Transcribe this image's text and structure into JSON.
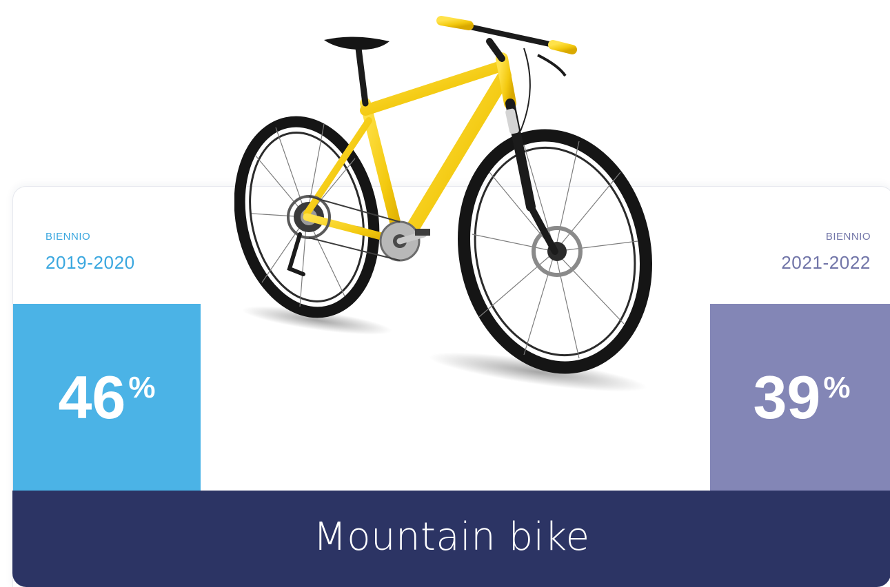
{
  "colors": {
    "left_accent": "#4bb3e6",
    "right_accent": "#8386b6",
    "footer_bg": "#2c3464",
    "left_text": "#3aa7df",
    "right_text": "#7175a8",
    "bike_frame": "#f5d01a"
  },
  "left_period": {
    "kicker": "BIENNIO",
    "years": "2019-2020",
    "value": "46",
    "unit": "%"
  },
  "right_period": {
    "kicker": "BIENNIO",
    "years": "2021-2022",
    "value": "39",
    "unit": "%"
  },
  "footer": {
    "label": "Mountain bike"
  },
  "illustration": {
    "icon": "mountain-bike-icon"
  }
}
